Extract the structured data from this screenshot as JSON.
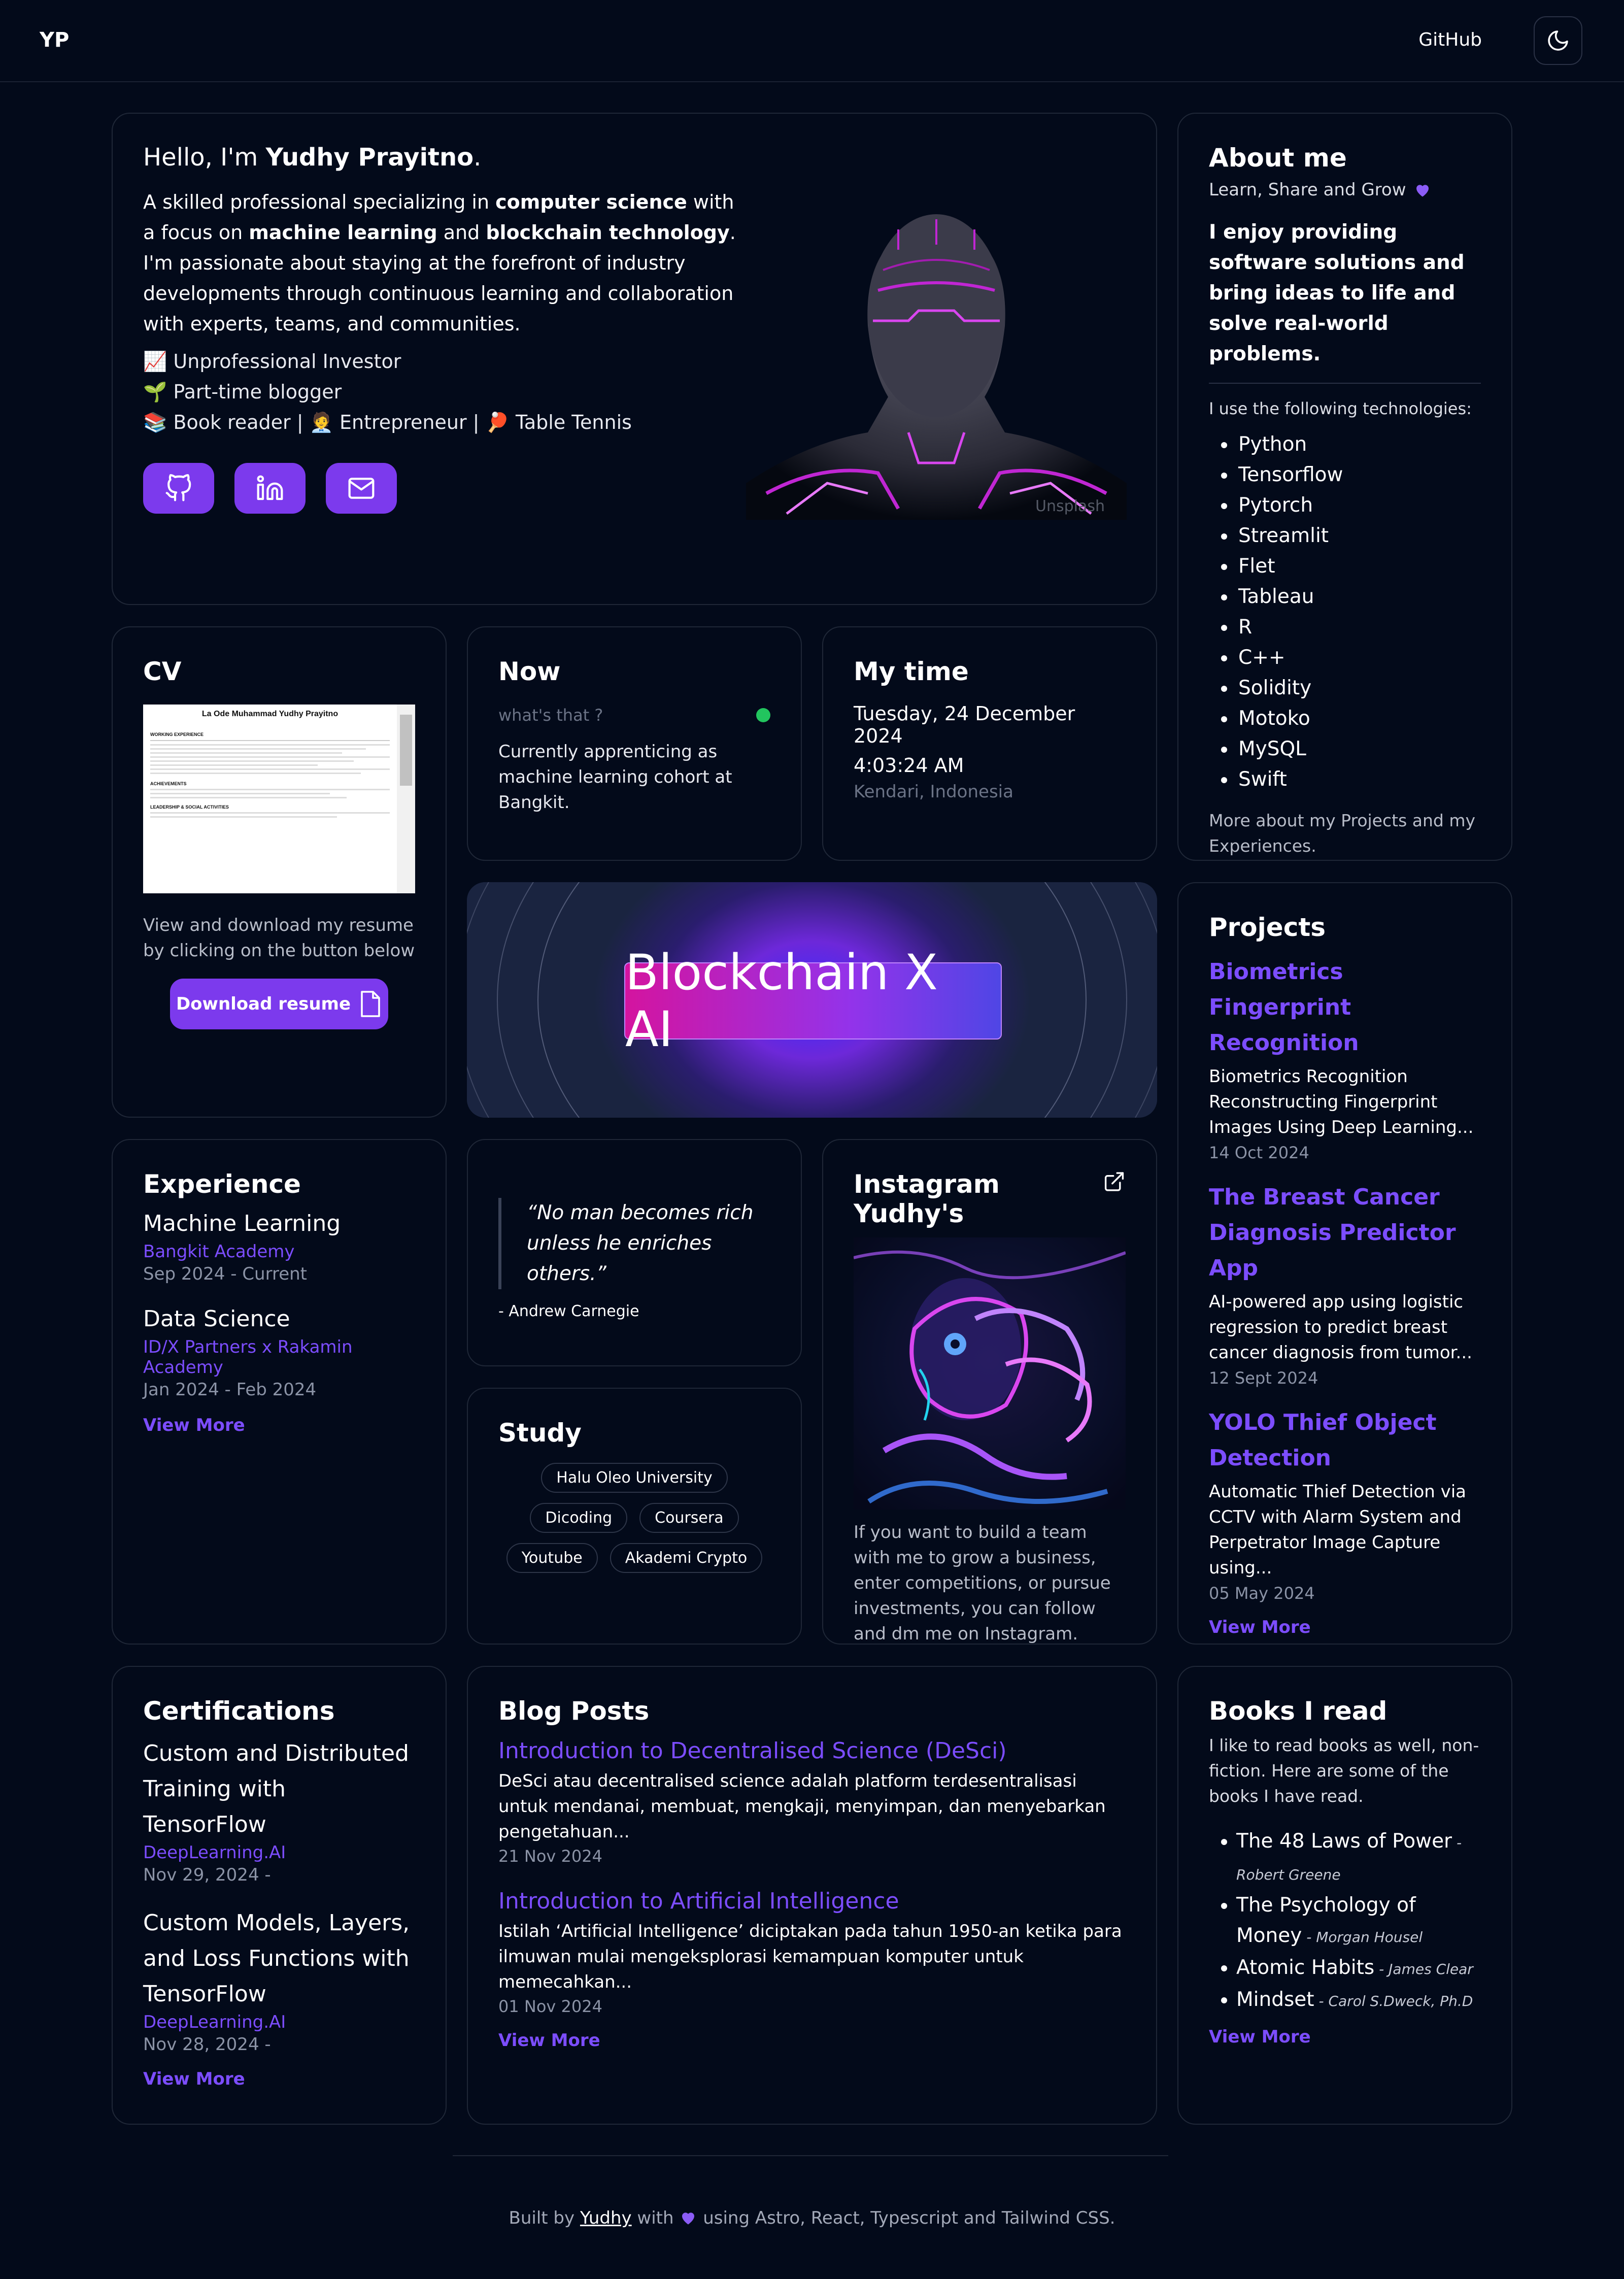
{
  "nav": {
    "logo": "YP",
    "github": "GitHub"
  },
  "hero": {
    "greeting_prefix": "Hello, I'm ",
    "name": "Yudhy Prayitno",
    "greeting_suffix": ".",
    "desc_1": "A skilled professional specializing in ",
    "desc_b1": "computer science",
    "desc_2": " with a focus on ",
    "desc_b2": "machine learning",
    "desc_3": " and ",
    "desc_b3": "blockchain technology",
    "desc_4": ". I'm passionate about staying at the forefront of industry developments through continuous learning and collaboration with experts, teams, and communities.",
    "line_1": "📈 Unprofessional Investor",
    "line_2": "🌱 Part-time blogger",
    "line_3": "📚 Book reader | 🧑‍💼 Entrepreneur | 🏓 Table Tennis",
    "image_watermark": "Unsplash"
  },
  "about": {
    "title": "About me",
    "subtitle": "Learn, Share and Grow",
    "bold": "I enjoy providing software solutions and bring ideas to life and solve real-world problems.",
    "tech_intro": "I use the following technologies:",
    "techs": [
      "Python",
      "Tensorflow",
      "Pytorch",
      "Streamlit",
      "Flet",
      "Tableau",
      "R",
      "C++",
      "Solidity",
      "Motoko",
      "MySQL",
      "Swift"
    ],
    "footer": "More about my Projects and my Experiences."
  },
  "cv": {
    "title": "CV",
    "desc": "View and download my resume by clicking on the button below",
    "button": "Download resume",
    "preview_name": "La Ode Muhammad Yudhy Prayitno",
    "preview_section_1": "WORKING EXPERIENCE",
    "preview_section_2": "ACHIEVEMENTS",
    "preview_section_3": "LEADERSHIP & SOCIAL ACTIVITIES"
  },
  "now": {
    "title": "Now",
    "subtitle": "what's that ?",
    "status_color": "#22c55e",
    "text": "Currently apprenticing as machine learning cohort at Bangkit."
  },
  "time": {
    "title": "My time",
    "date": "Tuesday, 24 December 2024",
    "clock": "4:03:24 AM",
    "place": "Kendari, Indonesia"
  },
  "banner": {
    "text": "Blockchain X AI"
  },
  "experience": {
    "title": "Experience",
    "items": [
      {
        "role": "Machine Learning",
        "org": "Bangkit Academy",
        "date": "Sep 2024 - Current"
      },
      {
        "role": "Data Science",
        "org": "ID/X Partners x Rakamin Academy",
        "date": "Jan 2024 - Feb 2024"
      }
    ],
    "view_more": "View More"
  },
  "quote": {
    "text": "“No man becomes rich unless he enriches others.”",
    "author": "- Andrew Carnegie"
  },
  "study": {
    "title": "Study",
    "pills": [
      "Halu Oleo University",
      "Dicoding",
      "Coursera",
      "Youtube",
      "Akademi Crypto"
    ]
  },
  "instagram": {
    "title": "Instagram Yudhy's",
    "text": "If you want to build a team with me to grow a business, enter competitions, or pursue investments, you can follow and dm me on Instagram."
  },
  "projects": {
    "title": "Projects",
    "items": [
      {
        "title": "Biometrics Fingerprint Recognition",
        "desc": "Biometrics Recognition Reconstructing Fingerprint Images Using Deep Learning...",
        "date": "14 Oct 2024"
      },
      {
        "title": "The Breast Cancer Diagnosis Predictor App",
        "desc": "AI-powered app using logistic regression to predict breast cancer diagnosis from tumor...",
        "date": "12 Sept 2024"
      },
      {
        "title": "YOLO Thief Object Detection",
        "desc": "Automatic Thief Detection via CCTV with Alarm System and Perpetrator Image Capture using...",
        "date": "05 May 2024"
      }
    ],
    "view_more": "View More"
  },
  "certs": {
    "title": "Certifications",
    "items": [
      {
        "title": "Custom and Distributed Training with TensorFlow",
        "org": "DeepLearning.AI",
        "date": "Nov 29, 2024 -"
      },
      {
        "title": "Custom Models, Layers, and Loss Functions with TensorFlow",
        "org": "DeepLearning.AI",
        "date": "Nov 28, 2024 -"
      }
    ],
    "view_more": "View More"
  },
  "blog": {
    "title": "Blog Posts",
    "items": [
      {
        "title": "Introduction to Decentralised Science (DeSci)",
        "desc": "DeSci atau decentralised science adalah platform terdesentralisasi untuk mendanai, membuat, mengkaji, menyimpan, dan menyebarkan pengetahuan...",
        "date": "21 Nov 2024"
      },
      {
        "title": "Introduction to Artificial Intelligence",
        "desc": "Istilah ‘Artificial Intelligence’ diciptakan pada tahun 1950-an ketika para ilmuwan mulai mengeksplorasi kemampuan komputer untuk memecahkan...",
        "date": "01 Nov 2024"
      }
    ],
    "view_more": "View More"
  },
  "books": {
    "title": "Books I read",
    "intro": "I like to read books as well, non-fiction. Here are some of the books I have read.",
    "items": [
      {
        "title": "The 48 Laws of Power",
        "author": "Robert Greene"
      },
      {
        "title": "The Psychology of Money",
        "author": "Morgan Housel"
      },
      {
        "title": "Atomic Habits",
        "author": "James Clear"
      },
      {
        "title": "Mindset",
        "author": "Carol S.Dweck, Ph.D"
      }
    ],
    "view_more": "View More"
  },
  "footer": {
    "prefix": "Built by ",
    "name": "Yudhy",
    "mid": " with ",
    "suffix": " using Astro, React, Typescript and Tailwind CSS."
  },
  "colors": {
    "accent": "#7c3aed",
    "background": "#030a1a",
    "link": "#7c4dff"
  }
}
